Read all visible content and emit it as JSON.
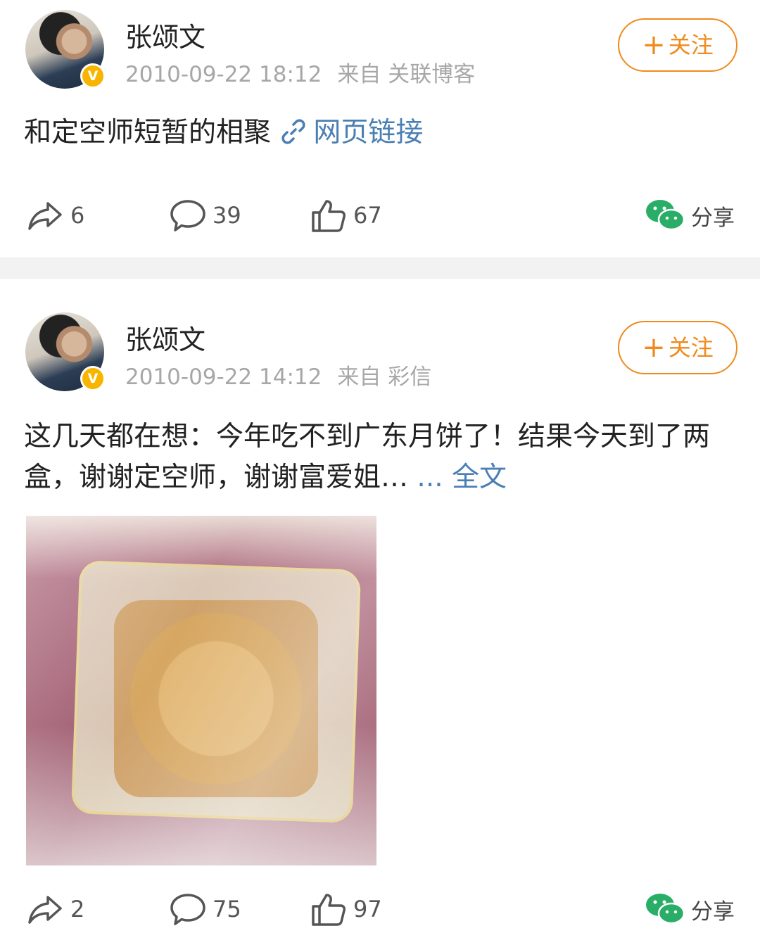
{
  "posts": [
    {
      "author": "张颂文",
      "time": "2010-09-22 18:12",
      "source": "来自 关联博客",
      "follow_label": "关注",
      "text": "和定空师短暂的相聚",
      "link_label": "网页链接",
      "reposts": "6",
      "comments": "39",
      "likes": "67",
      "share_label": "分享"
    },
    {
      "author": "张颂文",
      "time": "2010-09-22 14:12",
      "source": "来自 彩信",
      "follow_label": "关注",
      "text": "这几天都在想：今年吃不到广东月饼了！结果今天到了两盒，谢谢定空师，谢谢富爱姐…",
      "more_label": "... 全文",
      "reposts": "2",
      "comments": "75",
      "likes": "97",
      "share_label": "分享"
    }
  ],
  "colors": {
    "accent_orange": "#f08a1d",
    "link_blue": "#4a7fb3",
    "verified_gold": "#f7b500",
    "wechat_green": "#2aae67"
  },
  "icons": [
    "repost-icon",
    "comment-icon",
    "like-icon",
    "wechat-icon",
    "link-icon",
    "verified-badge-icon"
  ]
}
